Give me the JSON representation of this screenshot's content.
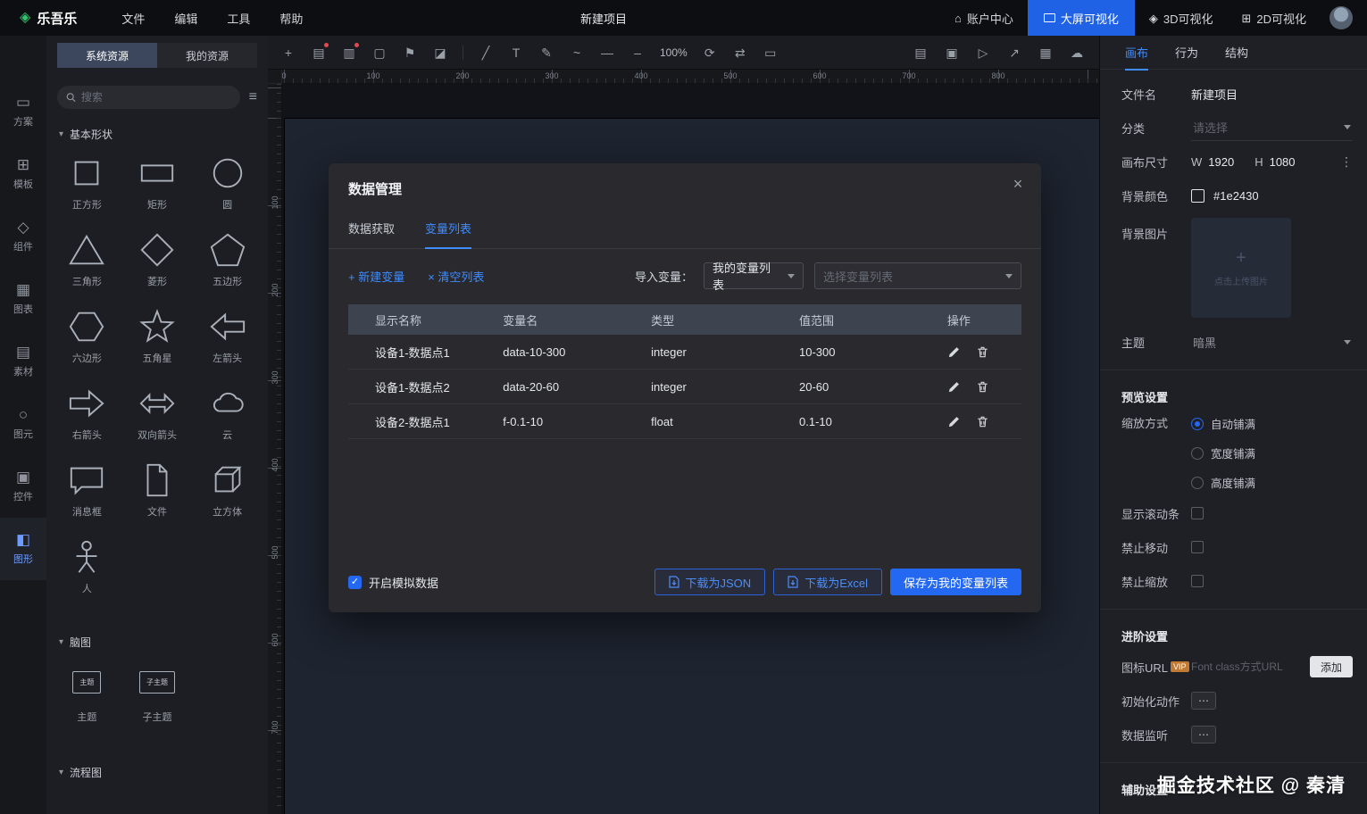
{
  "glyphs": {
    "logo": "◈",
    "home": "⌂",
    "cube_3d": "◈",
    "grid_2d": "⊞",
    "hamburger": "≡",
    "section_chevron": "▾",
    "vdots": "⋮",
    "more": "⋯",
    "check": "✓",
    "upload_plus": "+",
    "close": "×"
  },
  "topbar": {
    "logo": "乐吾乐",
    "menus": [
      "文件",
      "编辑",
      "工具",
      "帮助"
    ],
    "title": "新建项目",
    "account": "账户中心",
    "nav_items": [
      {
        "label": "大屏可视化",
        "active": true
      },
      {
        "label": "3D可视化",
        "active": false
      },
      {
        "label": "2D可视化",
        "active": false
      }
    ]
  },
  "rail": {
    "items": [
      {
        "label": "方案",
        "glyph": "▭",
        "active": false
      },
      {
        "label": "模板",
        "glyph": "⊞",
        "active": false
      },
      {
        "label": "组件",
        "glyph": "◇",
        "active": false
      },
      {
        "label": "图表",
        "glyph": "▦",
        "active": false
      },
      {
        "label": "素材",
        "glyph": "▤",
        "active": false
      },
      {
        "label": "图元",
        "glyph": "○",
        "active": false
      },
      {
        "label": "控件",
        "glyph": "▣",
        "active": false
      },
      {
        "label": "图形",
        "glyph": "◧",
        "active": true
      }
    ]
  },
  "panel": {
    "tabs": [
      {
        "label": "系统资源",
        "active": true
      },
      {
        "label": "我的资源",
        "active": false
      }
    ],
    "search_placeholder": "搜索",
    "sections": {
      "basic": {
        "title": "基本形状",
        "shapes": [
          "正方形",
          "矩形",
          "圆",
          "三角形",
          "菱形",
          "五边形",
          "六边形",
          "五角星",
          "左箭头",
          "右箭头",
          "双向箭头",
          "云",
          "消息框",
          "文件",
          "立方体",
          "人"
        ]
      },
      "mind": {
        "title": "脑图",
        "items": [
          "主题",
          "子主题"
        ]
      },
      "flow": {
        "title": "流程图"
      }
    }
  },
  "toolbar": {
    "zoom": "100%",
    "left_icons": [
      {
        "name": "add",
        "glyph": "+"
      },
      {
        "name": "save",
        "glyph": "▤"
      },
      {
        "name": "notes",
        "glyph": "▥"
      },
      {
        "name": "package",
        "glyph": "▢"
      },
      {
        "name": "flag",
        "glyph": "⚑"
      },
      {
        "name": "eraser",
        "glyph": "◪"
      }
    ],
    "draw_icons": [
      {
        "name": "line",
        "glyph": "╱"
      },
      {
        "name": "text",
        "glyph": "T"
      },
      {
        "name": "pen",
        "glyph": "✎"
      },
      {
        "name": "curve",
        "glyph": "~"
      },
      {
        "name": "solid-line",
        "glyph": "—"
      },
      {
        "name": "dashed-line",
        "glyph": "–"
      }
    ],
    "view_icons": [
      {
        "name": "refresh",
        "glyph": "⟳"
      },
      {
        "name": "fit-view",
        "glyph": "⇄"
      },
      {
        "name": "frame",
        "glyph": "▭"
      }
    ],
    "right_icons": [
      {
        "name": "layout",
        "glyph": "▤"
      },
      {
        "name": "clipboard",
        "glyph": "▣"
      },
      {
        "name": "play",
        "glyph": "▷"
      },
      {
        "name": "share",
        "glyph": "↗"
      },
      {
        "name": "qr-grid",
        "glyph": "▦"
      },
      {
        "name": "cloud",
        "glyph": "☁"
      }
    ]
  },
  "ruler": {
    "h": [
      "0",
      "100",
      "200",
      "300",
      "400",
      "500",
      "600",
      "700",
      "800"
    ],
    "v": [
      "100",
      "200",
      "300",
      "400",
      "500",
      "600",
      "700"
    ]
  },
  "modal": {
    "title": "数据管理",
    "tabs": [
      {
        "label": "数据获取",
        "active": false
      },
      {
        "label": "变量列表",
        "active": true
      }
    ],
    "new_variable": "+ 新建变量",
    "clear_list": "× 清空列表",
    "import_label": "导入变量：",
    "import_value": "我的变量列表",
    "import_placeholder": "选择变量列表",
    "table": {
      "headers": [
        "显示名称",
        "变量名",
        "类型",
        "值范围",
        "操作"
      ],
      "rows": [
        {
          "name": "设备1-数据点1",
          "variable": "data-10-300",
          "type": "integer",
          "range": "10-300"
        },
        {
          "name": "设备1-数据点2",
          "variable": "data-20-60",
          "type": "integer",
          "range": "20-60"
        },
        {
          "name": "设备2-数据点1",
          "variable": "f-0.1-10",
          "type": "float",
          "range": "0.1-10"
        }
      ]
    },
    "mock_label": "开启模拟数据",
    "mock_checked": true,
    "buttons": {
      "json": "下载为JSON",
      "excel": "下载为Excel",
      "save": "保存为我的变量列表"
    }
  },
  "inspector": {
    "tabs": [
      {
        "label": "画布",
        "active": true
      },
      {
        "label": "行为",
        "active": false
      },
      {
        "label": "结构",
        "active": false
      }
    ],
    "filename_label": "文件名",
    "filename_value": "新建项目",
    "category_label": "分类",
    "category_placeholder": "请选择",
    "size_label": "画布尺寸",
    "size_w_label": "W",
    "size_w": "1920",
    "size_h_label": "H",
    "size_h": "1080",
    "bg_color_label": "背景颜色",
    "bg_color": "#1e2430",
    "bg_image_label": "背景图片",
    "upload_hint": "点击上传图片",
    "theme_label": "主题",
    "theme_value": "暗黑",
    "preview_title": "预览设置",
    "scale_label": "缩放方式",
    "scale_options": [
      {
        "label": "自动铺满",
        "checked": true
      },
      {
        "label": "宽度铺满",
        "checked": false
      },
      {
        "label": "高度铺满",
        "checked": false
      }
    ],
    "toggle_scrollbar": "显示滚动条",
    "toggle_no_move": "禁止移动",
    "toggle_no_zoom": "禁止缩放",
    "advanced_title": "进阶设置",
    "icon_url_label": "图标URL",
    "vip": "VIP",
    "icon_url_placeholder": "Font class方式URL",
    "add_button": "添加",
    "init_action_label": "初始化动作",
    "data_listen_label": "数据监听",
    "assist_title": "辅助设置"
  },
  "watermark": "掘金技术社区 @ 秦清"
}
